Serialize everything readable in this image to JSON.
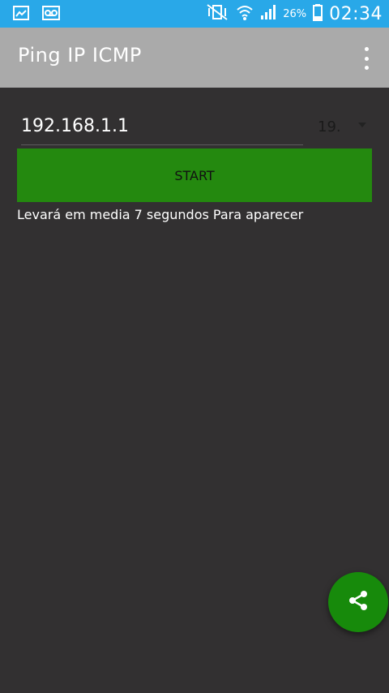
{
  "status_bar": {
    "battery_percent": "26%",
    "time": "02:34",
    "icons": [
      "image-notification-icon",
      "voicemail-icon",
      "vibrate-mute-icon",
      "wifi-icon",
      "signal-icon",
      "battery-icon"
    ]
  },
  "app_bar": {
    "title": "Ping IP ICMP",
    "menu_icon": "overflow-menu-icon"
  },
  "form": {
    "ip_value": "192.168.1.1",
    "count_value": "19.",
    "start_label": "START",
    "hint_text": "Levará em media 7 segundos Para aparecer"
  },
  "fab": {
    "icon": "share-icon"
  },
  "colors": {
    "status_bar": "#29a8e8",
    "app_bar": "#aaaaaa",
    "background": "#323031",
    "button": "#24890f",
    "fab": "#178a0b"
  }
}
